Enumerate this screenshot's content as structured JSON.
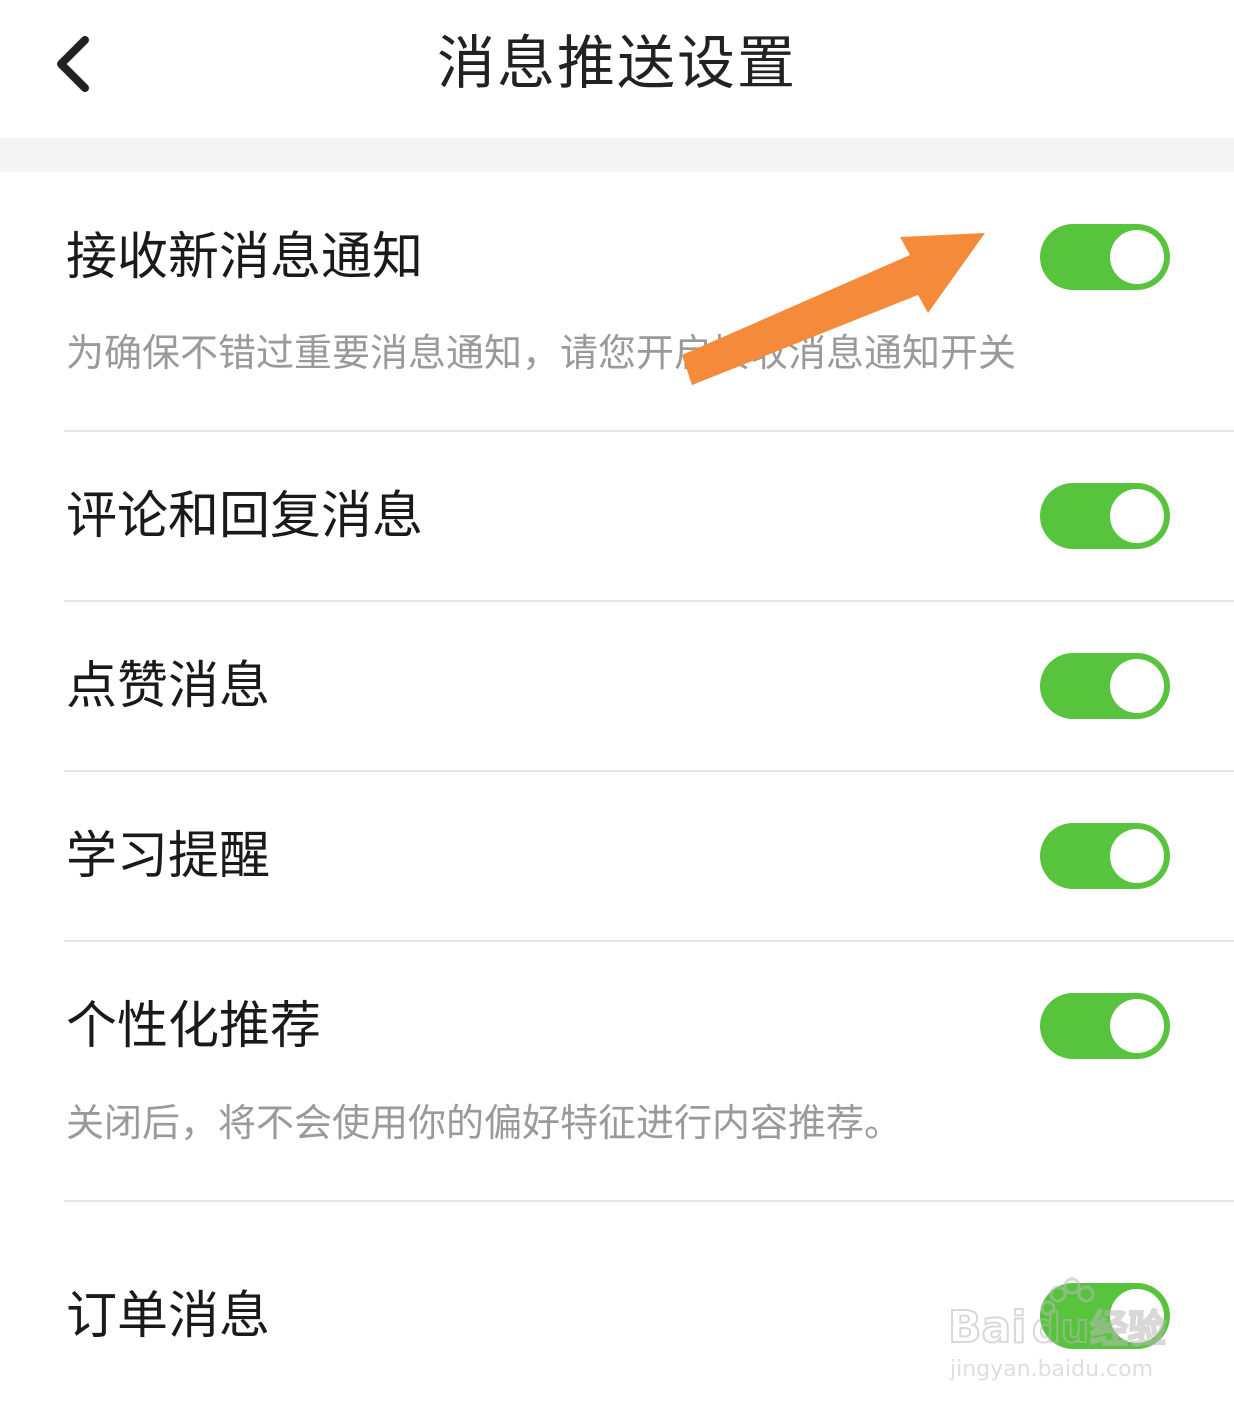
{
  "header": {
    "title": "消息推送设置",
    "back_icon": "chevron-left-icon"
  },
  "settings": [
    {
      "title": "接收新消息通知",
      "description": "为确保不错过重要消息通知，请您开启接收消息通知开关",
      "enabled": true
    },
    {
      "title": "评论和回复消息",
      "description": "",
      "enabled": true
    },
    {
      "title": "点赞消息",
      "description": "",
      "enabled": true
    },
    {
      "title": "学习提醒",
      "description": "",
      "enabled": true
    },
    {
      "title": "个性化推荐",
      "description": "关闭后，将不会使用你的偏好特征进行内容推荐。",
      "enabled": true
    },
    {
      "title": "订单消息",
      "description": "",
      "enabled": true
    }
  ],
  "colors": {
    "toggle_on": "#58c33d",
    "annotation_arrow": "#f58a3a"
  }
}
